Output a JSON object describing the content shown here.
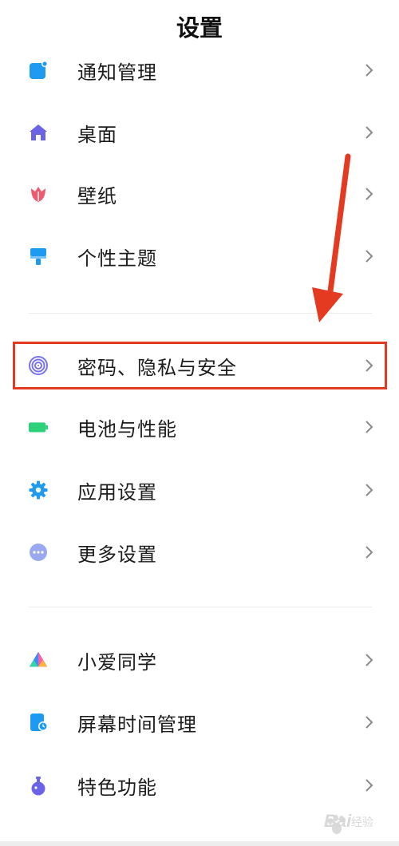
{
  "header": {
    "title": "设置"
  },
  "groups": [
    {
      "items": [
        {
          "label": "通知管理",
          "icon": "notification-icon"
        },
        {
          "label": "桌面",
          "icon": "home-icon"
        },
        {
          "label": "壁纸",
          "icon": "wallpaper-tulip-icon"
        },
        {
          "label": "个性主题",
          "icon": "theme-brush-icon"
        }
      ]
    },
    {
      "items": [
        {
          "label": "密码、隐私与安全",
          "icon": "fingerprint-icon",
          "highlighted": true
        },
        {
          "label": "电池与性能",
          "icon": "battery-icon"
        },
        {
          "label": "应用设置",
          "icon": "app-settings-gear-icon"
        },
        {
          "label": "更多设置",
          "icon": "more-dots-icon"
        }
      ]
    },
    {
      "items": [
        {
          "label": "小爱同学",
          "icon": "xiaoai-assistant-icon"
        },
        {
          "label": "屏幕时间管理",
          "icon": "screen-time-icon"
        },
        {
          "label": "特色功能",
          "icon": "special-features-flask-icon"
        }
      ]
    }
  ],
  "annotations": {
    "highlight_color": "#e43a21",
    "arrow_color": "#e43a21"
  },
  "watermark": {
    "brand": "Bai",
    "sub": "经验"
  }
}
